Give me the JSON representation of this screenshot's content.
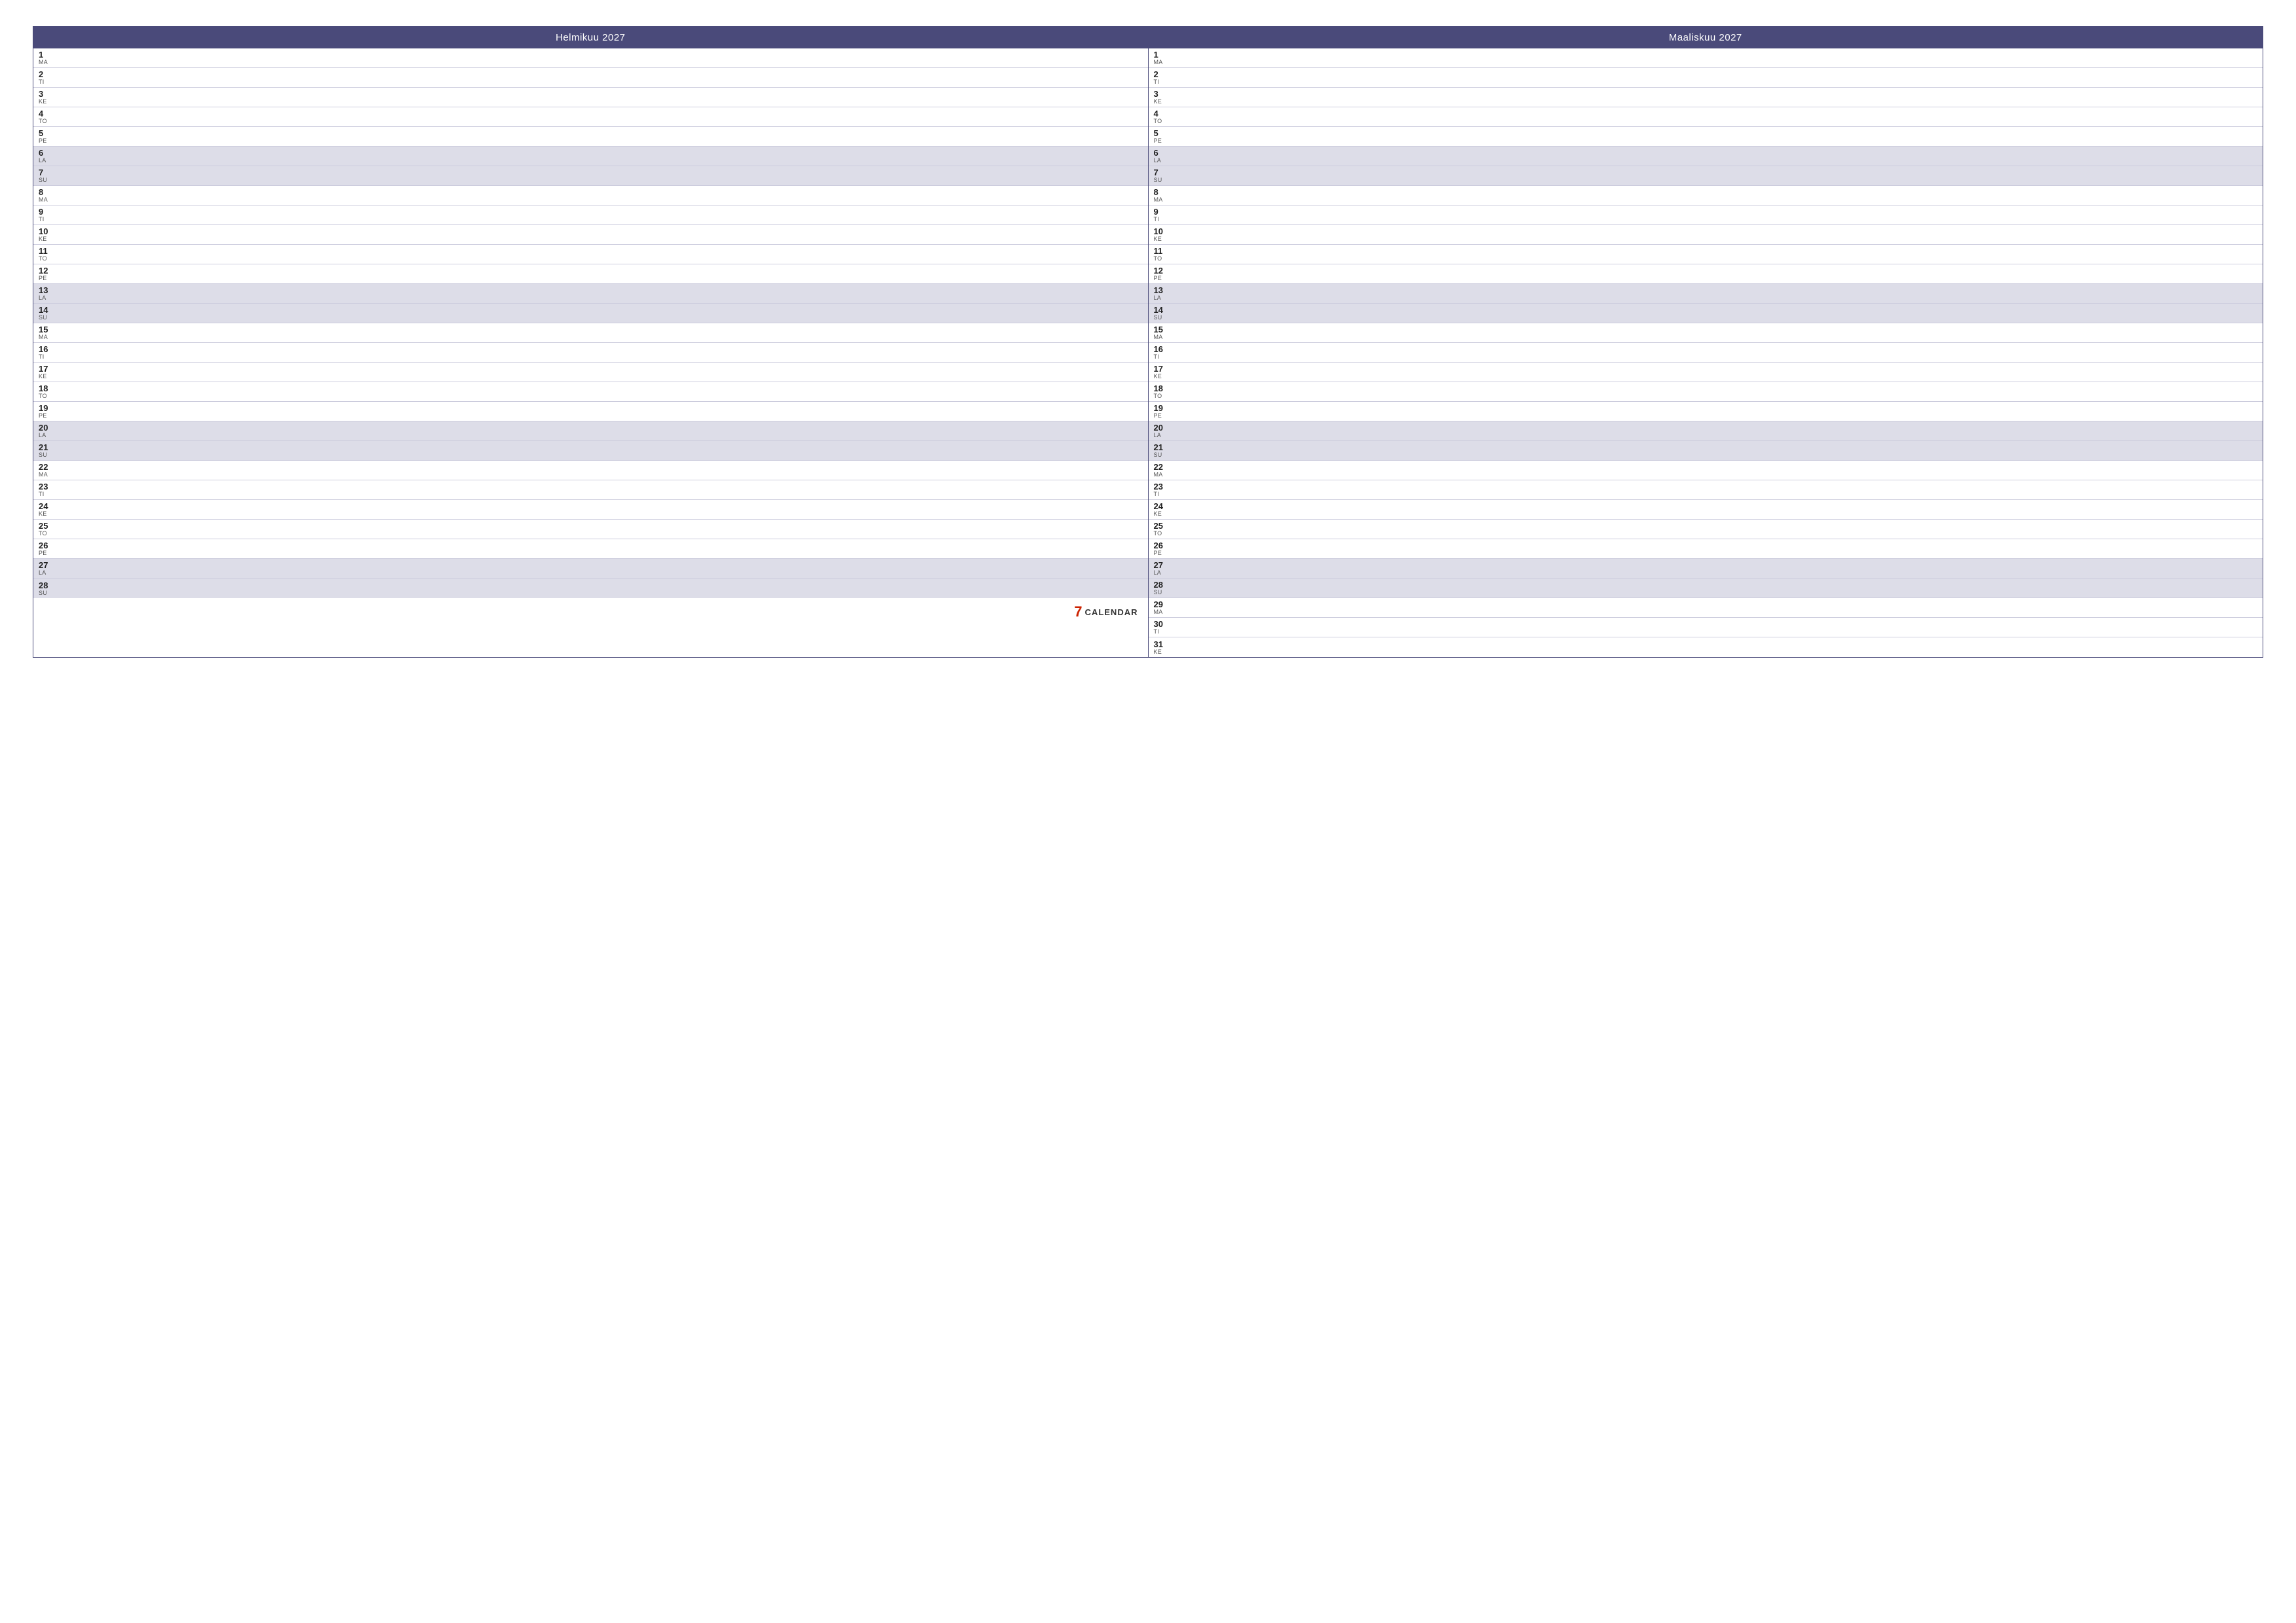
{
  "calendar": {
    "months": [
      {
        "id": "helmikuu-2027",
        "title": "Helmikuu 2027",
        "days": [
          {
            "number": "1",
            "name": "MA",
            "weekend": false
          },
          {
            "number": "2",
            "name": "TI",
            "weekend": false
          },
          {
            "number": "3",
            "name": "KE",
            "weekend": false
          },
          {
            "number": "4",
            "name": "TO",
            "weekend": false
          },
          {
            "number": "5",
            "name": "PE",
            "weekend": false
          },
          {
            "number": "6",
            "name": "LA",
            "weekend": true
          },
          {
            "number": "7",
            "name": "SU",
            "weekend": true
          },
          {
            "number": "8",
            "name": "MA",
            "weekend": false
          },
          {
            "number": "9",
            "name": "TI",
            "weekend": false
          },
          {
            "number": "10",
            "name": "KE",
            "weekend": false
          },
          {
            "number": "11",
            "name": "TO",
            "weekend": false
          },
          {
            "number": "12",
            "name": "PE",
            "weekend": false
          },
          {
            "number": "13",
            "name": "LA",
            "weekend": true
          },
          {
            "number": "14",
            "name": "SU",
            "weekend": true
          },
          {
            "number": "15",
            "name": "MA",
            "weekend": false
          },
          {
            "number": "16",
            "name": "TI",
            "weekend": false
          },
          {
            "number": "17",
            "name": "KE",
            "weekend": false
          },
          {
            "number": "18",
            "name": "TO",
            "weekend": false
          },
          {
            "number": "19",
            "name": "PE",
            "weekend": false
          },
          {
            "number": "20",
            "name": "LA",
            "weekend": true
          },
          {
            "number": "21",
            "name": "SU",
            "weekend": true
          },
          {
            "number": "22",
            "name": "MA",
            "weekend": false
          },
          {
            "number": "23",
            "name": "TI",
            "weekend": false
          },
          {
            "number": "24",
            "name": "KE",
            "weekend": false
          },
          {
            "number": "25",
            "name": "TO",
            "weekend": false
          },
          {
            "number": "26",
            "name": "PE",
            "weekend": false
          },
          {
            "number": "27",
            "name": "LA",
            "weekend": true
          },
          {
            "number": "28",
            "name": "SU",
            "weekend": true
          }
        ]
      },
      {
        "id": "maaliskuu-2027",
        "title": "Maaliskuu 2027",
        "days": [
          {
            "number": "1",
            "name": "MA",
            "weekend": false
          },
          {
            "number": "2",
            "name": "TI",
            "weekend": false
          },
          {
            "number": "3",
            "name": "KE",
            "weekend": false
          },
          {
            "number": "4",
            "name": "TO",
            "weekend": false
          },
          {
            "number": "5",
            "name": "PE",
            "weekend": false
          },
          {
            "number": "6",
            "name": "LA",
            "weekend": true
          },
          {
            "number": "7",
            "name": "SU",
            "weekend": true
          },
          {
            "number": "8",
            "name": "MA",
            "weekend": false
          },
          {
            "number": "9",
            "name": "TI",
            "weekend": false
          },
          {
            "number": "10",
            "name": "KE",
            "weekend": false
          },
          {
            "number": "11",
            "name": "TO",
            "weekend": false
          },
          {
            "number": "12",
            "name": "PE",
            "weekend": false
          },
          {
            "number": "13",
            "name": "LA",
            "weekend": true
          },
          {
            "number": "14",
            "name": "SU",
            "weekend": true
          },
          {
            "number": "15",
            "name": "MA",
            "weekend": false
          },
          {
            "number": "16",
            "name": "TI",
            "weekend": false
          },
          {
            "number": "17",
            "name": "KE",
            "weekend": false
          },
          {
            "number": "18",
            "name": "TO",
            "weekend": false
          },
          {
            "number": "19",
            "name": "PE",
            "weekend": false
          },
          {
            "number": "20",
            "name": "LA",
            "weekend": true
          },
          {
            "number": "21",
            "name": "SU",
            "weekend": true
          },
          {
            "number": "22",
            "name": "MA",
            "weekend": false
          },
          {
            "number": "23",
            "name": "TI",
            "weekend": false
          },
          {
            "number": "24",
            "name": "KE",
            "weekend": false
          },
          {
            "number": "25",
            "name": "TO",
            "weekend": false
          },
          {
            "number": "26",
            "name": "PE",
            "weekend": false
          },
          {
            "number": "27",
            "name": "LA",
            "weekend": true
          },
          {
            "number": "28",
            "name": "SU",
            "weekend": true
          },
          {
            "number": "29",
            "name": "MA",
            "weekend": false
          },
          {
            "number": "30",
            "name": "TI",
            "weekend": false
          },
          {
            "number": "31",
            "name": "KE",
            "weekend": false
          }
        ]
      }
    ],
    "logo": {
      "number": "7",
      "text": "CALENDAR"
    }
  }
}
